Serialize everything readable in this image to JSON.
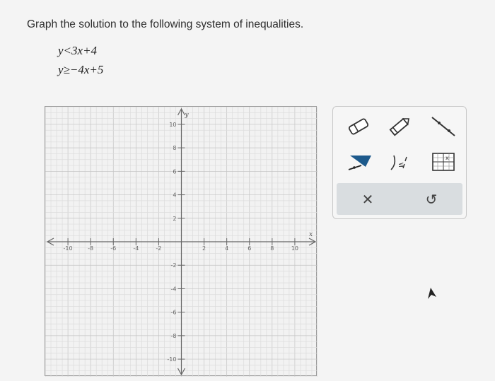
{
  "question": {
    "title": "Graph the solution to the following system of inequalities.",
    "inequalities": [
      "y<3x+4",
      "y≥−4x+5"
    ]
  },
  "graph": {
    "x_range": [
      -12,
      12
    ],
    "y_range": [
      -11.5,
      11.5
    ],
    "x_tick_labels": [
      "-10",
      "-8",
      "-6",
      "-4",
      "-2",
      "2",
      "4",
      "6",
      "8",
      "10"
    ],
    "y_tick_labels": [
      "10",
      "8",
      "6",
      "4",
      "2",
      "-2",
      "-4",
      "-6",
      "-8",
      "-10"
    ],
    "x_axis_label": "x",
    "y_axis_label": "y",
    "grid": true
  },
  "tools": {
    "items": [
      "eraser-icon",
      "pencil-icon",
      "line-tool-icon",
      "region-fill-icon",
      "inequality-dashed-line-icon",
      "graph-shading-icon"
    ],
    "clear_label": "✕",
    "undo_label": "↺"
  }
}
